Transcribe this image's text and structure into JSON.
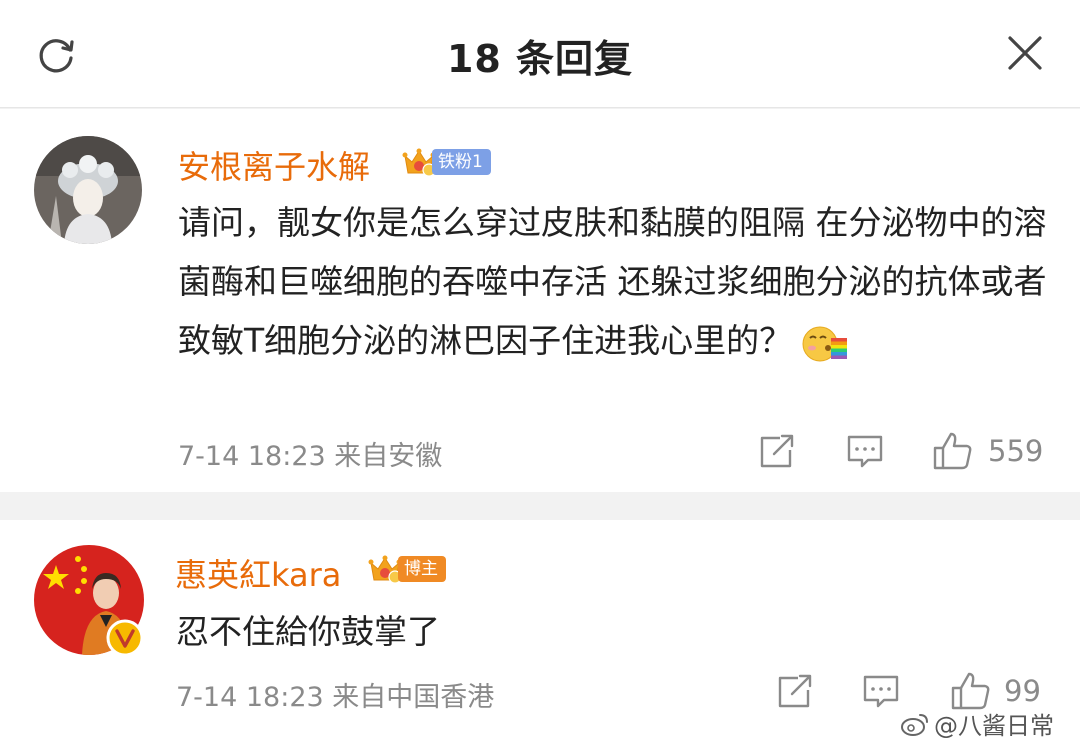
{
  "header": {
    "title": "18 条回复"
  },
  "comments": [
    {
      "username": "安根离子水解",
      "badge": "铁粉1",
      "text": "请问，靓女你是怎么穿过皮肤和黏膜的阻隔 在分泌物中的溶菌酶和巨噬细胞的吞噬中存活 还躲过浆细胞分泌的抗体或者致敏T细胞分泌的淋巴因子住进我心里的？",
      "meta": "7-14 18:23  来自安徽",
      "likes": "559"
    },
    {
      "username": "惠英紅kara",
      "badge": "博主",
      "text": "忍不住給你鼓掌了",
      "meta": "7-14 18:23  来自中国香港",
      "likes": "99"
    }
  ],
  "watermark": "@八酱日常",
  "colors": {
    "username": "#e86b0a",
    "fan_badge": "#7da0e6",
    "blogger_badge": "#f08a24",
    "meta": "#8a8a8a"
  }
}
